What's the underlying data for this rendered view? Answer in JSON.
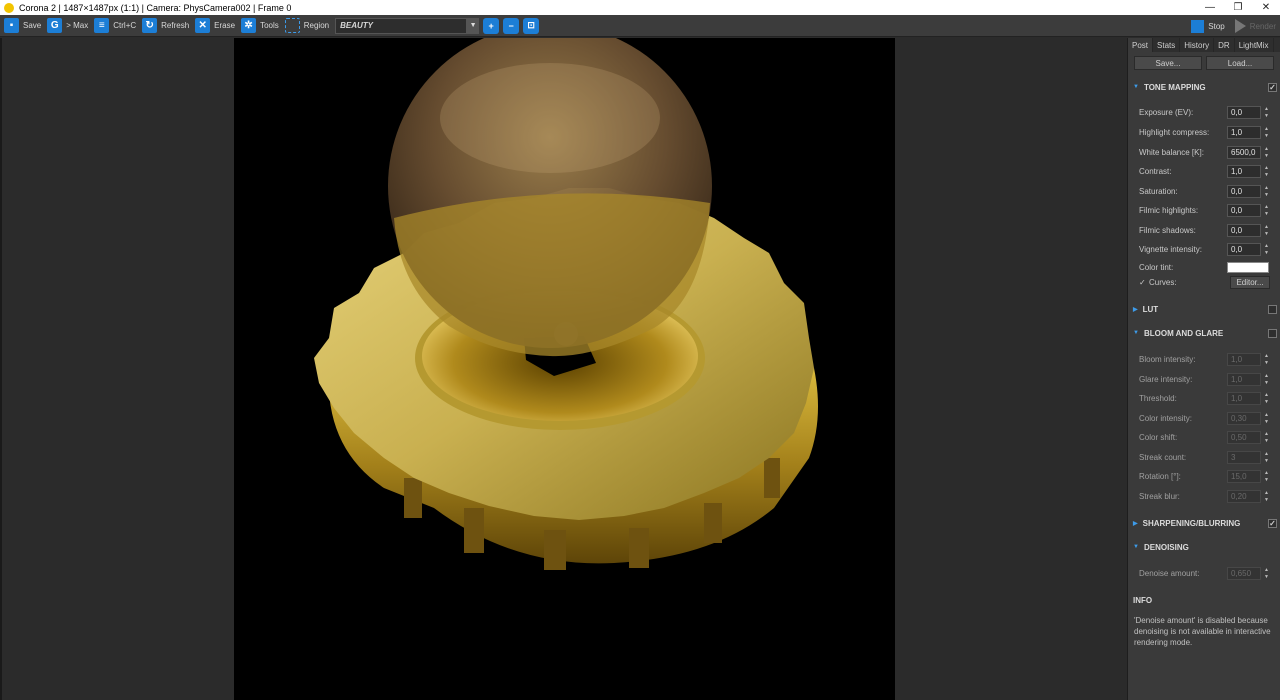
{
  "window": {
    "title": "Corona 2 | 1487×1487px (1:1) | Camera: PhysCamera002 | Frame 0",
    "controls": [
      "—",
      "❐",
      "✕"
    ]
  },
  "toolbar": {
    "save_label": "Save",
    "max_label": "> Max",
    "copy_label": "Ctrl+C",
    "refresh_label": "Refresh",
    "erase_label": "Erase",
    "tools_label": "Tools",
    "region_label": "Region",
    "beauty_value": "BEAUTY",
    "stop_label": "Stop",
    "render_label": "Render"
  },
  "panel": {
    "tabs": [
      "Post",
      "Stats",
      "History",
      "DR",
      "LightMix"
    ],
    "save_button": "Save...",
    "load_button": "Load...",
    "tone_mapping": {
      "title": "TONE MAPPING",
      "enabled": "✓",
      "fields": [
        {
          "label": "Exposure (EV):",
          "value": "0,0"
        },
        {
          "label": "Highlight compress:",
          "value": "1,0"
        },
        {
          "label": "White balance [K]:",
          "value": "6500,0"
        },
        {
          "label": "Contrast:",
          "value": "1,0"
        },
        {
          "label": "Saturation:",
          "value": "0,0"
        },
        {
          "label": "Filmic highlights:",
          "value": "0,0"
        },
        {
          "label": "Filmic shadows:",
          "value": "0,0"
        },
        {
          "label": "Vignette intensity:",
          "value": "0,0"
        }
      ],
      "color_tint_label": "Color tint:",
      "color_tint_value": "#ffffff",
      "curves_label": "Curves:",
      "curves_checked": "✓",
      "editor_button": "Editor..."
    },
    "lut": {
      "title": "LUT"
    },
    "bloom_glare": {
      "title": "BLOOM AND GLARE",
      "fields": [
        {
          "label": "Bloom intensity:",
          "value": "1,0"
        },
        {
          "label": "Glare intensity:",
          "value": "1,0"
        },
        {
          "label": "Threshold:",
          "value": "1,0"
        },
        {
          "label": "Color intensity:",
          "value": "0,30"
        },
        {
          "label": "Color shift:",
          "value": "0,50"
        },
        {
          "label": "Streak count:",
          "value": "3"
        },
        {
          "label": "Rotation [°]:",
          "value": "15,0"
        },
        {
          "label": "Streak blur:",
          "value": "0,20"
        }
      ]
    },
    "sharpening": {
      "title": "SHARPENING/BLURRING",
      "enabled": "✓"
    },
    "denoising": {
      "title": "DENOISING",
      "amount_label": "Denoise amount:",
      "amount_value": "0,650"
    },
    "info": {
      "title": "INFO",
      "text": "'Denoise amount' is disabled because denoising is not available in interactive rendering mode."
    }
  },
  "colors": {
    "accent": "#1c7ed6",
    "panel_bg": "#3a3a3a",
    "toolbar_bg": "#3c3c3c",
    "render_bg": "#000000",
    "gold": "#c9a227"
  }
}
